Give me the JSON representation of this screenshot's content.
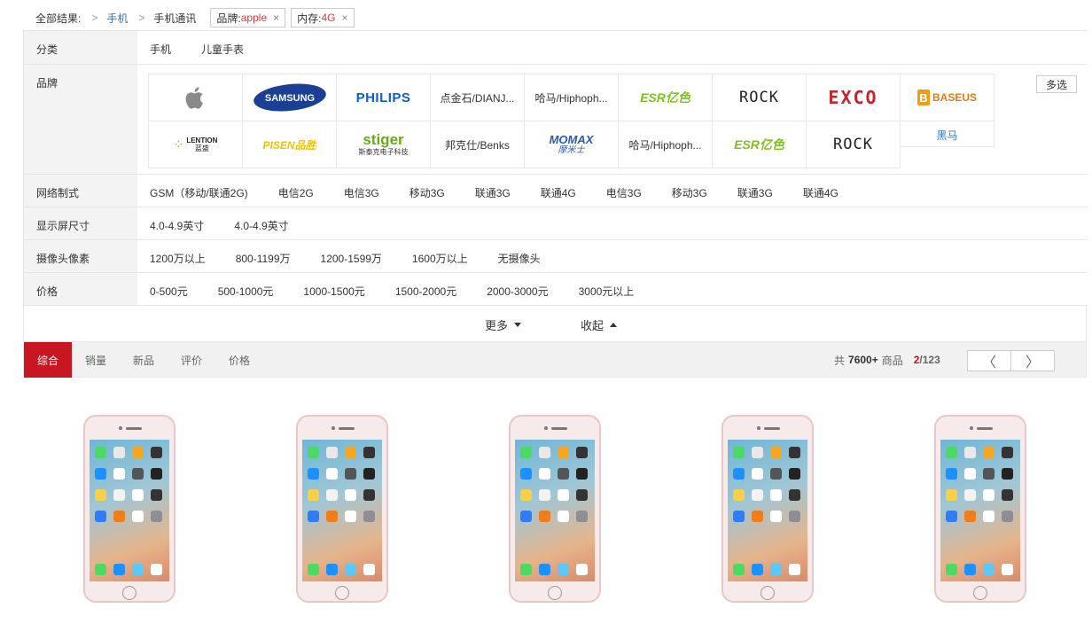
{
  "breadcrumb": {
    "root": "全部结果:",
    "sep": ">",
    "level1": "手机",
    "level2": "手机通讯",
    "tags": [
      {
        "key": "品牌:",
        "value": "apple"
      },
      {
        "key": "内存:",
        "value": "4G"
      }
    ],
    "tag_close": "×"
  },
  "filters": {
    "category": {
      "label": "分类",
      "values": [
        "手机",
        "儿童手表"
      ]
    },
    "brand": {
      "label": "品牌",
      "multi_select": "多选",
      "row1": [
        {
          "kind": "logo",
          "name": "apple-logo"
        },
        {
          "kind": "logo",
          "name": "samsung-logo",
          "text": "SAMSUNG"
        },
        {
          "kind": "logo",
          "name": "philips-logo",
          "text": "PHILIPS"
        },
        {
          "kind": "text",
          "text": "点金石/DIANJ..."
        },
        {
          "kind": "text",
          "text": "哈马/Hiphoph..."
        },
        {
          "kind": "logo",
          "name": "esr-logo",
          "text": "ESR亿色"
        },
        {
          "kind": "logo",
          "name": "rock-logo",
          "text": "ROCK"
        },
        {
          "kind": "logo",
          "name": "exco-logo",
          "text": "EXCO"
        },
        {
          "kind": "logo",
          "name": "baseus-logo",
          "text": "BASEUS"
        }
      ],
      "row2": [
        {
          "kind": "logo",
          "name": "lention-logo",
          "text": "LENTION",
          "sub": "蓝盛"
        },
        {
          "kind": "logo",
          "name": "pisen-logo",
          "text": "PISEN品胜"
        },
        {
          "kind": "logo",
          "name": "stiger-logo",
          "text": "stiger",
          "sub": "斯泰克电子科技"
        },
        {
          "kind": "text",
          "text": "邦克仕/Benks"
        },
        {
          "kind": "logo",
          "name": "momax-logo",
          "text": "MOMAX",
          "sub": "摩米士"
        },
        {
          "kind": "text",
          "text": "哈马/Hiphoph..."
        },
        {
          "kind": "logo",
          "name": "esr-logo",
          "text": "ESR亿色"
        },
        {
          "kind": "logo",
          "name": "rock-logo",
          "text": "ROCK"
        },
        {
          "kind": "link",
          "text": "黑马"
        }
      ]
    },
    "network": {
      "label": "网络制式",
      "values": [
        "GSM（移动/联通2G)",
        "电信2G",
        "电信3G",
        "移动3G",
        "联通3G",
        "联通4G",
        "电信3G",
        "移动3G",
        "联通3G",
        "联通4G"
      ]
    },
    "screen": {
      "label": "显示屏尺寸",
      "values": [
        "4.0-4.9英寸",
        "4.0-4.9英寸"
      ]
    },
    "camera": {
      "label": "摄像头像素",
      "values": [
        "1200万以上",
        "800-1199万",
        "1200-1599万",
        "1600万以上",
        "无摄像头"
      ]
    },
    "price": {
      "label": "价格",
      "values": [
        "0-500元",
        "500-1000元",
        "1000-1500元",
        "1500-2000元",
        "2000-3000元",
        "3000元以上"
      ]
    },
    "more": "更多",
    "collapse": "收起"
  },
  "sort": {
    "items": [
      "综合",
      "销量",
      "新品",
      "评价",
      "价格"
    ],
    "active_index": 0,
    "summary_prefix": "共",
    "summary_count": "7600+",
    "summary_suffix": "商品",
    "page_current": "2",
    "page_total": "/123",
    "prev": "〈",
    "next": "〉"
  },
  "colors": {
    "accent": "#c81623",
    "link": "#2b79c2",
    "tag_value": "#e4393c"
  },
  "products": [
    {
      "image": "iphone-rose-gold"
    },
    {
      "image": "iphone-rose-gold"
    },
    {
      "image": "iphone-rose-gold"
    },
    {
      "image": "iphone-rose-gold"
    },
    {
      "image": "iphone-rose-gold"
    }
  ]
}
